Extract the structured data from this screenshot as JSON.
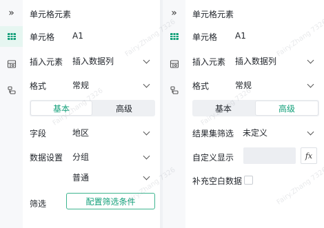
{
  "left": {
    "title": "单元格元素",
    "cell_label": "单元格",
    "cell_value": "A1",
    "insert_label": "插入元素",
    "insert_value": "插入数据列",
    "format_label": "格式",
    "format_value": "常规",
    "tab_basic": "基本",
    "tab_advanced": "高级",
    "field_label": "字段",
    "field_value": "地区",
    "data_setting_label": "数据设置",
    "data_setting_value": "分组",
    "data_setting_mode": "普通",
    "filter_label": "筛选",
    "filter_button": "配置筛选条件"
  },
  "right": {
    "title": "单元格元素",
    "cell_label": "单元格",
    "cell_value": "A1",
    "insert_label": "插入元素",
    "insert_value": "插入数据列",
    "format_label": "格式",
    "format_value": "常规",
    "tab_basic": "基本",
    "tab_advanced": "高级",
    "result_filter_label": "结果集筛选",
    "result_filter_value": "未定义",
    "custom_display_label": "自定义显示",
    "fx_label": "fx",
    "fill_blank_label": "补充空白数据"
  },
  "watermark": "Fairy.Zhang 7326",
  "colors": {
    "accent": "#13a07a",
    "accent_border": "#3db58f",
    "sidebar_bg": "#f7f8fa",
    "active_icon_bg": "#e6f6f1"
  },
  "icons": [
    "double-chevron-right-icon",
    "cell-grid-icon",
    "insert-element-icon",
    "data-bind-icon",
    "chevron-down-icon"
  ]
}
